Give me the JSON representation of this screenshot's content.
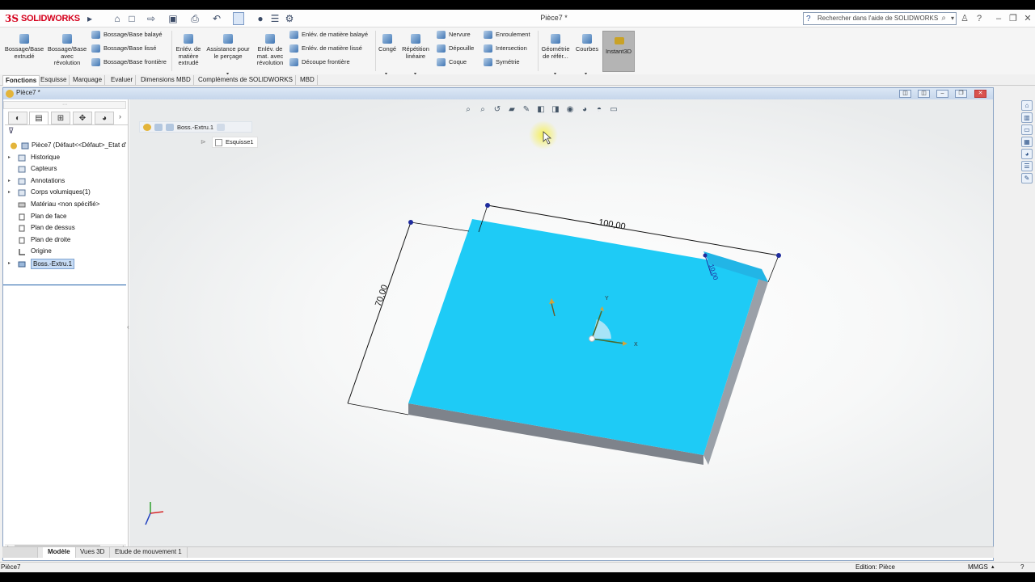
{
  "app": {
    "title": "Pièce7 *",
    "logo": "SOLIDWORKS"
  },
  "search": {
    "placeholder": "Rechercher dans l'aide de SOLIDWORKS"
  },
  "ribbon": {
    "extrude_boss": "Bossage/Base extrudé",
    "revolve_boss": "Bossage/Base avec révolution",
    "swept_boss": "Bossage/Base balayé",
    "lofted_boss": "Bossage/Base lissé",
    "boundary_boss": "Bossage/Base frontière",
    "extruded_cut": "Enlév. de matière extrudé",
    "hole_wizard": "Assistance pour le perçage",
    "revolved_cut": "Enlév. de mat. avec révolution",
    "swept_cut": "Enlév. de matière balayé",
    "lofted_cut": "Enlév. de matière lissé",
    "boundary_cut": "Découpe frontière",
    "fillet": "Congé",
    "linear_pattern": "Répétition linéaire",
    "rib": "Nervure",
    "draft": "Dépouille",
    "shell": "Coque",
    "wrap": "Enroulement",
    "intersect": "Intersection",
    "mirror": "Symétrie",
    "ref_geometry": "Géométrie de référ...",
    "curves": "Courbes",
    "instant3d": "Instant3D"
  },
  "tabs": [
    "Fonctions",
    "Esquisse",
    "Marquage",
    "Evaluer",
    "Dimensions MBD",
    "Compléments de SOLIDWORKS",
    "MBD"
  ],
  "doc_window": {
    "title": "Pièce7 *"
  },
  "feature_tree": {
    "root": "Pièce7  (Défaut<<Défaut>_Etat d'",
    "items": [
      {
        "label": "Historique",
        "expandable": true
      },
      {
        "label": "Capteurs",
        "expandable": false
      },
      {
        "label": "Annotations",
        "expandable": true
      },
      {
        "label": "Corps volumiques(1)",
        "expandable": true
      },
      {
        "label": "Matériau <non spécifié>",
        "expandable": false
      },
      {
        "label": "Plan de face",
        "expandable": false
      },
      {
        "label": "Plan de dessus",
        "expandable": false
      },
      {
        "label": "Plan de droite",
        "expandable": false
      },
      {
        "label": "Origine",
        "expandable": false
      },
      {
        "label": "Boss.-Extru.1",
        "expandable": true,
        "selected": true
      }
    ]
  },
  "breadcrumb": {
    "feature": "Boss.-Extru.1",
    "sketch": "Esquisse1"
  },
  "dimensions": {
    "width": "100,00",
    "depth": "70,00",
    "thickness": "10,00"
  },
  "triad": {
    "x": "X",
    "y": "Y"
  },
  "bottom_tabs": [
    "Modèle",
    "Vues 3D",
    "Etude de mouvement 1"
  ],
  "status": {
    "left": "Pièce7",
    "mode": "Edition: Pièce",
    "units": "MMGS"
  },
  "colors": {
    "part_face": "#1ecbf6",
    "part_side": "#8a8f97",
    "selection": "#c7dcf5"
  }
}
